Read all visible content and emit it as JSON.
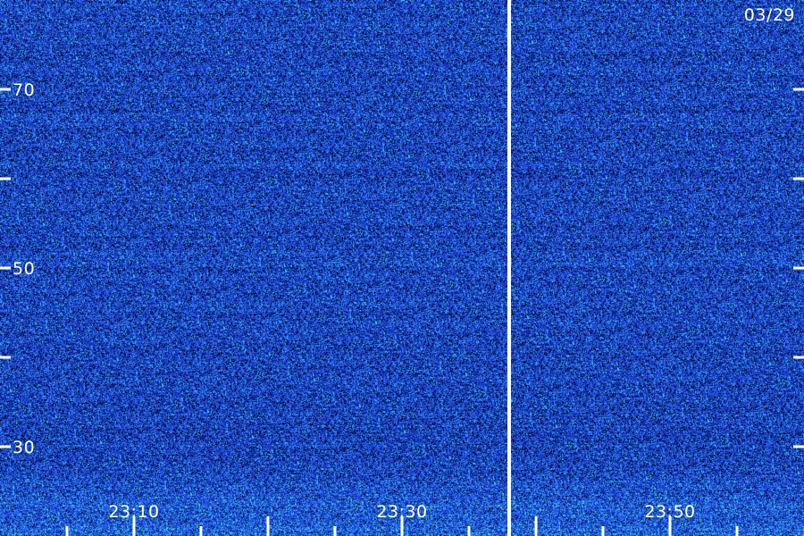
{
  "chart_data": {
    "type": "heatmap",
    "title": "",
    "date_label": "03/29",
    "xlabel": "",
    "ylabel": "",
    "x_tick_labels": [
      "23:10",
      "23:30",
      "23:50"
    ],
    "y_tick_labels": [
      "70",
      "50",
      "30"
    ],
    "x_range": [
      "23:00",
      "24:00"
    ],
    "y_range": [
      20,
      80
    ],
    "y_major_ticks": [
      30,
      40,
      50,
      60,
      70,
      80
    ],
    "x_minor_step_minutes": 5,
    "gap_time": "23:38",
    "grid": false,
    "colormap": [
      "#000000",
      "#0b1a6e",
      "#1f3fd0",
      "#2a6cff",
      "#35c6f0",
      "#4dff9a"
    ]
  }
}
